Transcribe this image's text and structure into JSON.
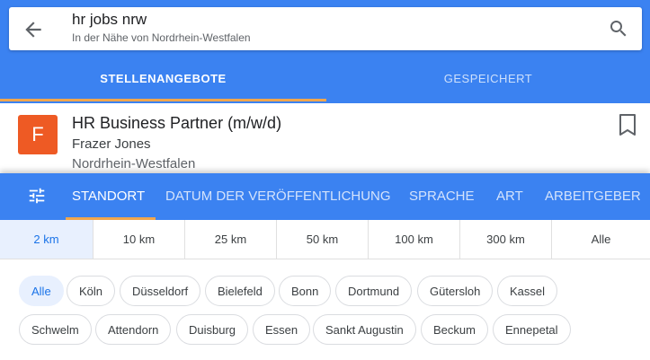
{
  "search": {
    "query": "hr jobs nrw",
    "location_hint": "In der Nähe von Nordrhein-Westfalen",
    "back_icon": "arrow-back-icon",
    "search_icon": "search-icon"
  },
  "tabs": [
    {
      "label": "STELLENANGEBOTE",
      "active": true
    },
    {
      "label": "GESPEICHERT",
      "active": false
    }
  ],
  "job": {
    "logo_letter": "F",
    "logo_color": "#ee5a24",
    "title": "HR Business Partner (m/w/d)",
    "company": "Frazer Jones",
    "location": "Nordrhein-Westfalen",
    "bookmark_icon": "bookmark-outline-icon"
  },
  "filter_tabs": {
    "icon": "tune-icon",
    "items": [
      {
        "label": "STANDORT",
        "active": true
      },
      {
        "label": "DATUM DER VERÖFFENTLICHUNG",
        "active": false
      },
      {
        "label": "SPRACHE",
        "active": false
      },
      {
        "label": "ART",
        "active": false
      },
      {
        "label": "ARBEITGEBER",
        "active": false
      }
    ]
  },
  "distances": [
    {
      "label": "2 km",
      "selected": true
    },
    {
      "label": "10 km",
      "selected": false
    },
    {
      "label": "25 km",
      "selected": false
    },
    {
      "label": "50 km",
      "selected": false
    },
    {
      "label": "100 km",
      "selected": false
    },
    {
      "label": "300 km",
      "selected": false
    },
    {
      "label": "Alle",
      "selected": false
    }
  ],
  "cities_row1": [
    {
      "label": "Alle",
      "selected": true
    },
    {
      "label": "Köln"
    },
    {
      "label": "Düsseldorf"
    },
    {
      "label": "Bielefeld"
    },
    {
      "label": "Bonn"
    },
    {
      "label": "Dortmund"
    },
    {
      "label": "Gütersloh"
    },
    {
      "label": "Kassel"
    }
  ],
  "cities_row2": [
    {
      "label": "Schwelm"
    },
    {
      "label": "Attendorn"
    },
    {
      "label": "Duisburg"
    },
    {
      "label": "Essen"
    },
    {
      "label": "Sankt Augustin"
    },
    {
      "label": "Beckum"
    },
    {
      "label": "Ennepetal"
    }
  ],
  "colors": {
    "primary_blue": "#3b82f1",
    "accent_orange": "#f0a64e",
    "selected_chip_bg": "#e8f0fe",
    "selected_chip_text": "#1a73e8"
  }
}
